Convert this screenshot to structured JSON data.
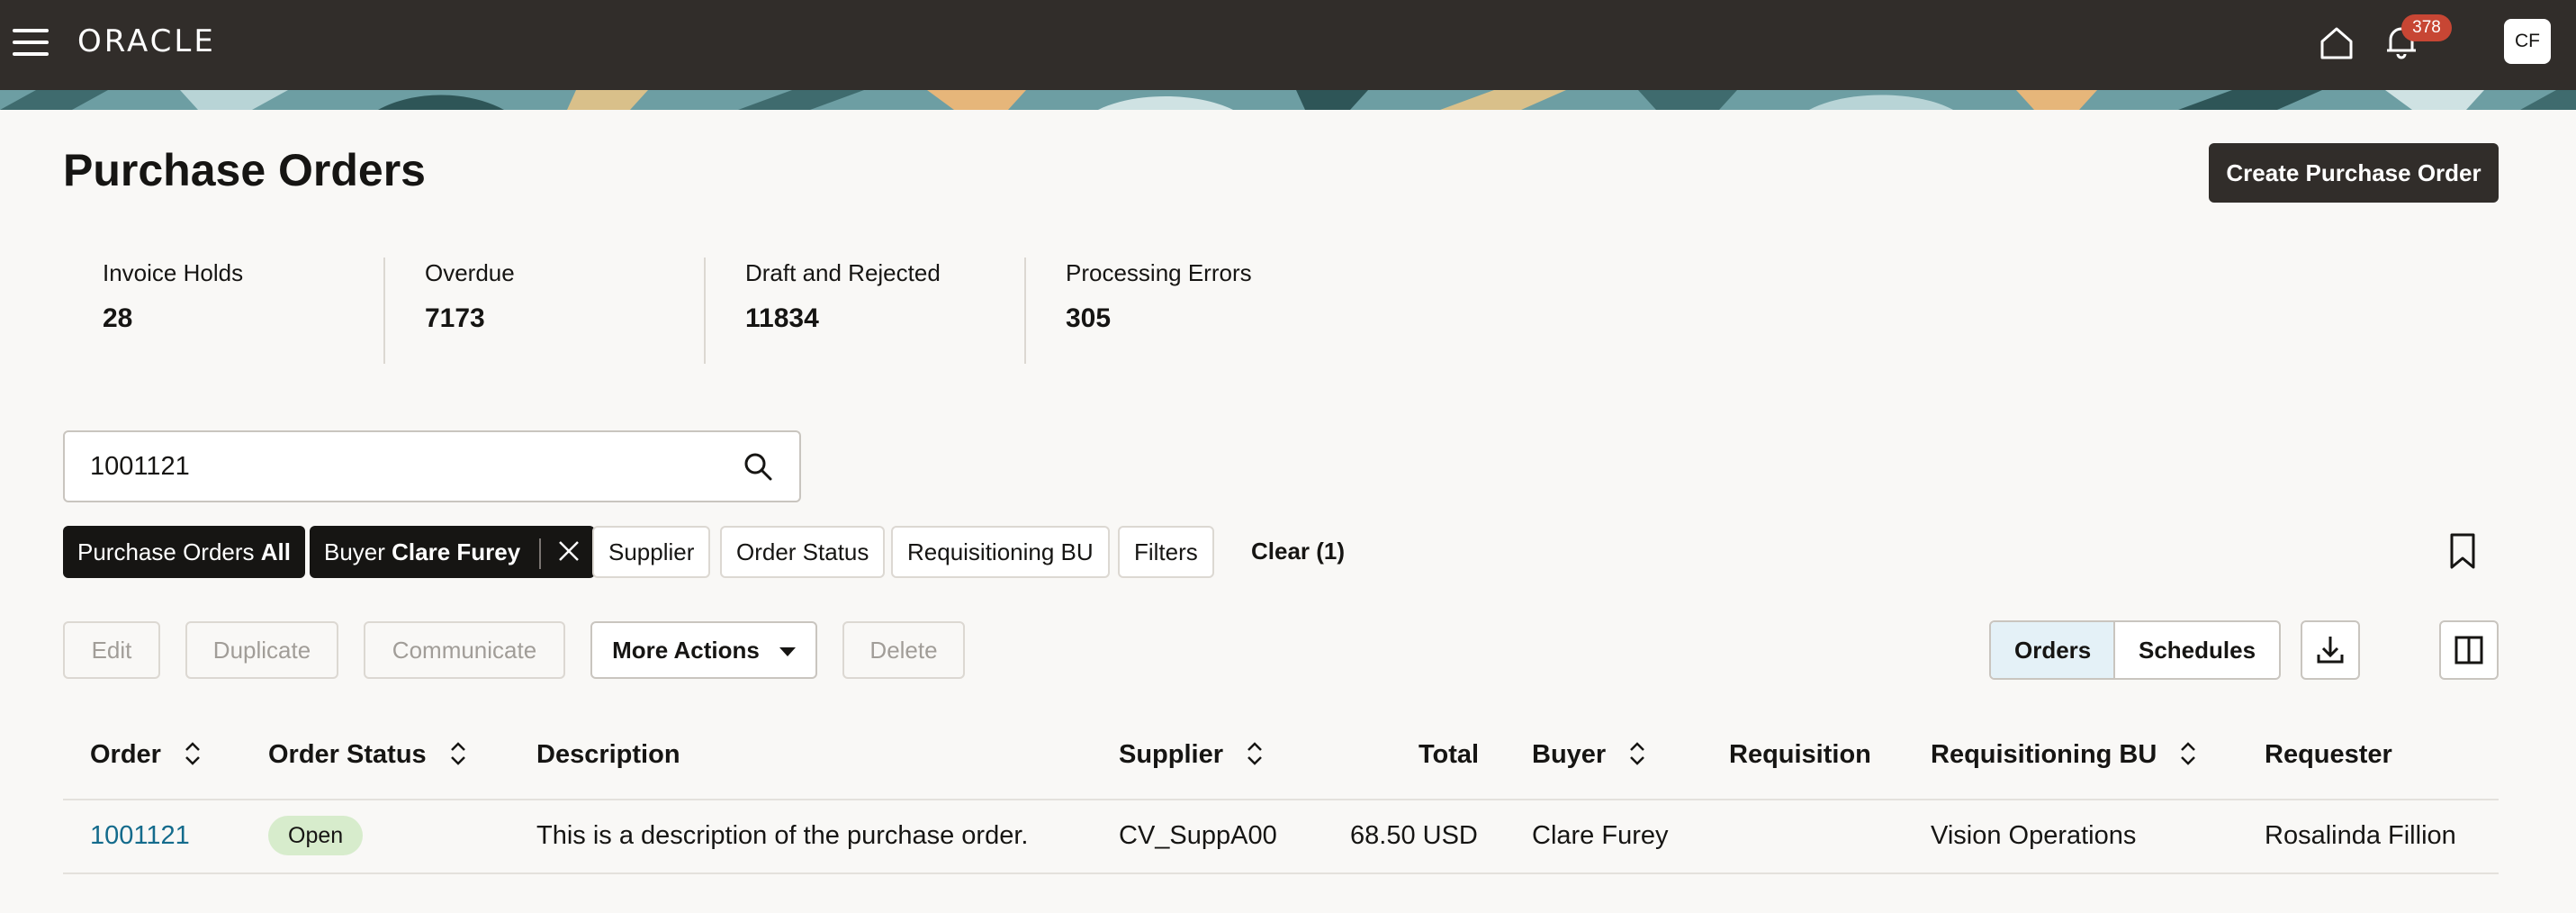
{
  "header": {
    "logo_text": "ORACLE",
    "notification_count": "378",
    "avatar_initials": "CF"
  },
  "page": {
    "title": "Purchase Orders",
    "create_label": "Create Purchase Order"
  },
  "metrics": [
    {
      "label": "Invoice Holds",
      "value": "28"
    },
    {
      "label": "Overdue",
      "value": "7173"
    },
    {
      "label": "Draft and Rejected",
      "value": "11834"
    },
    {
      "label": "Processing Errors",
      "value": "305"
    }
  ],
  "search": {
    "value": "1001121"
  },
  "filters": {
    "purchase_orders": {
      "label": "Purchase Orders",
      "value": "All"
    },
    "buyer": {
      "label": "Buyer",
      "value": "Clare Furey"
    },
    "supplier": "Supplier",
    "order_status": "Order Status",
    "requisitioning_bu": "Requisitioning BU",
    "filters": "Filters",
    "clear": "Clear (1)"
  },
  "toolbar": {
    "edit": "Edit",
    "duplicate": "Duplicate",
    "communicate": "Communicate",
    "more_actions": "More Actions",
    "delete": "Delete",
    "view_orders": "Orders",
    "view_schedules": "Schedules"
  },
  "table": {
    "columns": {
      "order": "Order",
      "order_status": "Order Status",
      "description": "Description",
      "supplier": "Supplier",
      "total": "Total",
      "buyer": "Buyer",
      "requisition": "Requisition",
      "requisitioning_bu": "Requisitioning BU",
      "requester": "Requester"
    },
    "rows": [
      {
        "order": "1001121",
        "order_status": "Open",
        "description": "This is a description of the purchase order.",
        "supplier": "CV_SuppA00",
        "total": "68.50 USD",
        "buyer": "Clare Furey",
        "requisition": "",
        "requisitioning_bu": "Vision Operations",
        "requester": "Rosalinda Fillion"
      }
    ]
  },
  "colors": {
    "topbar": "#312d2a",
    "link": "#146b8c",
    "badge": "#c74634",
    "status_open": "#d7eccc"
  }
}
